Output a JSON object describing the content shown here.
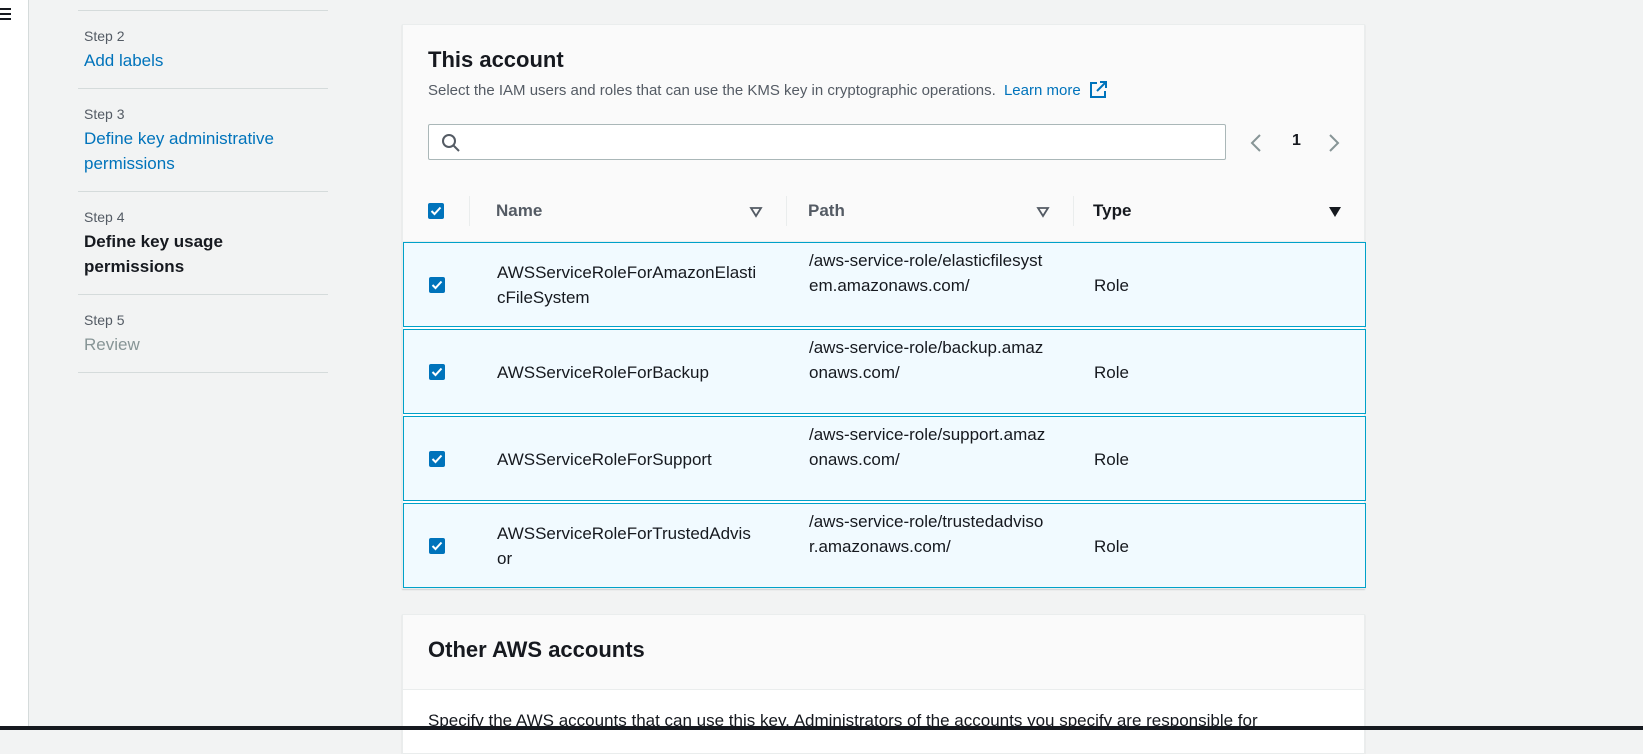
{
  "nav": {
    "steps": [
      {
        "num": "Step 2",
        "title": "Add labels"
      },
      {
        "num": "Step 3",
        "title": "Define key administrative permissions"
      },
      {
        "num": "Step 4",
        "title": "Define key usage permissions"
      },
      {
        "num": "Step 5",
        "title": "Review"
      }
    ]
  },
  "this_account": {
    "title": "This account",
    "description": "Select the IAM users and roles that can use the KMS key in cryptographic operations.",
    "learn_more": "Learn more",
    "search_placeholder": "",
    "search_value": "",
    "page": "1",
    "columns": {
      "name": "Name",
      "path": "Path",
      "type": "Type"
    },
    "rows": [
      {
        "name": "AWSServiceRoleForAmazonElasticFileSystem",
        "path": "/aws-service-role/elasticfilesystem.amazonaws.com/",
        "type": "Role",
        "checked": true
      },
      {
        "name": "AWSServiceRoleForBackup",
        "path": "/aws-service-role/backup.amazonaws.com/",
        "type": "Role",
        "checked": true
      },
      {
        "name": "AWSServiceRoleForSupport",
        "path": "/aws-service-role/support.amazonaws.com/",
        "type": "Role",
        "checked": true
      },
      {
        "name": "AWSServiceRoleForTrustedAdvisor",
        "path": "/aws-service-role/trustedadvisor.amazonaws.com/",
        "type": "Role",
        "checked": true
      }
    ]
  },
  "other_accounts": {
    "title": "Other AWS accounts",
    "description": "Specify the AWS accounts that can use this key. Administrators of the accounts you specify are responsible for"
  },
  "colors": {
    "link": "#0073bb",
    "accent": "#0073bb",
    "selected_row_bg": "#f1faff",
    "selected_row_border": "#00a1c9"
  }
}
